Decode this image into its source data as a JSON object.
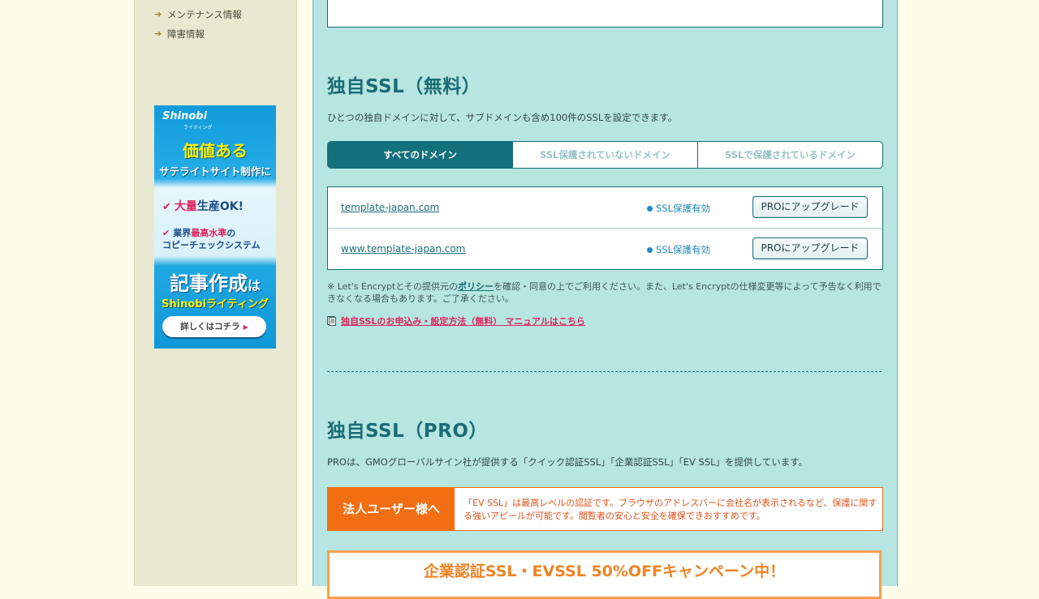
{
  "sidebar": {
    "links": [
      {
        "label": "メンテナンス情報"
      },
      {
        "label": "障害情報"
      }
    ],
    "banner": {
      "logo": "Shinobi",
      "logo_sub": "ライティング",
      "headline": "価値ある",
      "subheadline": "サテライトサイト制作に",
      "point1_a": "大量",
      "point1_b": "生産OK!",
      "point2_a": "業界",
      "point2_b": "最高水準",
      "point2_c": "の",
      "point2_d": "コピーチェックシステム",
      "main_a": "記事作成",
      "main_b": "は",
      "service": "Shinobiライティング",
      "button": "詳しくはコチラ"
    }
  },
  "ssl_free": {
    "title": "独自SSL（無料）",
    "description": "ひとつの独自ドメインに対して、サブドメインも含め100件のSSLを設定できます。",
    "tabs": [
      {
        "label": "すべてのドメイン",
        "active": true
      },
      {
        "label": "SSL保護されていないドメイン",
        "active": false
      },
      {
        "label": "SSLで保護されているドメイン",
        "active": false
      }
    ],
    "domains": [
      {
        "name": "template-japan.com",
        "status": "SSL保護有効",
        "action": "PROにアップグレード"
      },
      {
        "name": "www.template-japan.com",
        "status": "SSL保護有効",
        "action": "PROにアップグレード"
      }
    ],
    "note_pre": "※ Let's Encryptとその提供元の",
    "note_link": "ポリシー",
    "note_post": "を確認・同意の上でご利用ください。また、Let's Encryptの仕様変更等によって予告なく利用できなくなる場合もあります。ご了承ください。",
    "manual_link": "独自SSLのお申込み・設定方法（無料） マニュアルはこちら"
  },
  "ssl_pro": {
    "title": "独自SSL（PRO）",
    "description": "PROは、GMOグローバルサイン社が提供する「クイック認証SSL」「企業認証SSL」「EV SSL」を提供しています。",
    "callout_label": "法人ユーザー様へ",
    "callout_text": "「EV SSL」は最高レベルの認証です。ブラウザのアドレスバーに会社名が表示されるなど、保護に関する強いアピールが可能です。閲覧者の安心と安全を確保できおすすめです。",
    "campaign_title": "企業認証SSL・EVSSL 50%OFFキャンペーン中！"
  },
  "colors": {
    "accent": "#13707d",
    "panel": "#b7e5e1",
    "warning": "#f26e12",
    "link_pink": "#e0245e"
  }
}
